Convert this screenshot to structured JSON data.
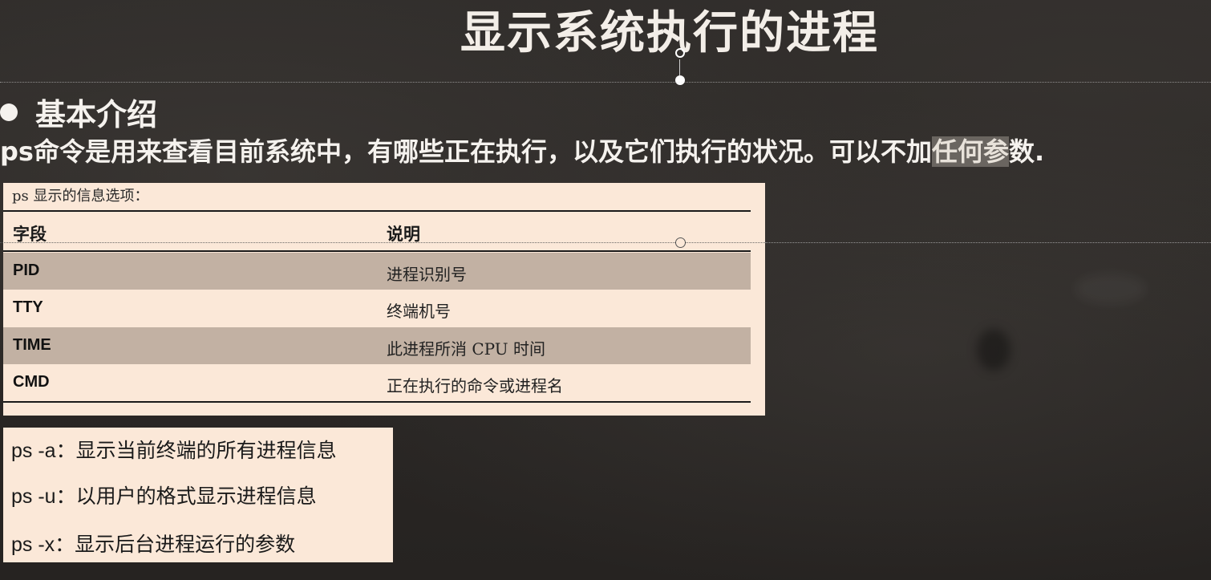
{
  "slide": {
    "title": "显示系统执行的进程",
    "section_heading": "基本介绍",
    "intro": {
      "text_before": "ps命令是用来查看目前系统中，有哪些正在执行，以及它们执行的状况。可以不加",
      "highlight": "任何参",
      "text_after": "数."
    }
  },
  "info_table": {
    "caption": "ps 显示的信息选项：",
    "headers": [
      "字段",
      "说明"
    ],
    "rows": [
      {
        "field": "PID",
        "desc": "进程识别号"
      },
      {
        "field": "TTY",
        "desc": "终端机号"
      },
      {
        "field": "TIME",
        "desc": "此进程所消 CPU 时间"
      },
      {
        "field": "CMD",
        "desc": "正在执行的命令或进程名"
      }
    ]
  },
  "options": [
    "ps -a：显示当前终端的所有进程信息",
    "ps -u：以用户的格式显示进程信息",
    "ps -x：显示后台进程运行的参数"
  ],
  "colors": {
    "background": "#2a2725",
    "panel": "#fbe8d8",
    "row_shade": "#c2b1a3",
    "title_text": "#f3eee8"
  }
}
